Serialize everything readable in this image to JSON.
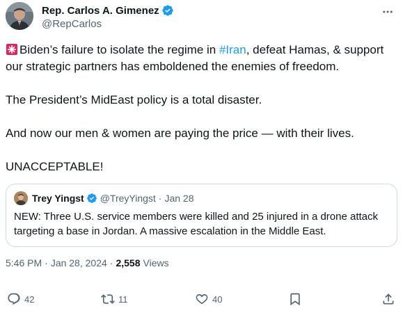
{
  "author": {
    "display_name": "Rep. Carlos A. Gimenez",
    "handle": "@RepCarlos"
  },
  "tweet": {
    "siren_icon": "police-siren-emoji",
    "line1_pre": "Biden’s failure to isolate the regime in ",
    "hashtag": "#Iran",
    "line1_post": ", defeat Hamas, & support our strategic partners has emboldened the enemies of freedom.",
    "para2": "The President’s MidEast policy is a total disaster.",
    "para3": "And now our men & women are paying the price — with their lives.",
    "para4": "UNACCEPTABLE!"
  },
  "quote": {
    "name": "Trey Yingst",
    "handle": "@TreyYingst",
    "date": "Jan 28",
    "text": "NEW: Three U.S. service members were killed and 25 injured in a drone attack targeting a base in Jordan. A massive escalation in the Middle East."
  },
  "meta": {
    "time": "5:46 PM",
    "date": "Jan 28, 2024",
    "views_count": "2,558",
    "views_label": "Views"
  },
  "actions": {
    "replies": "42",
    "reposts": "11",
    "likes": "40"
  },
  "colors": {
    "accent": "#1d9bf0",
    "text": "#0f1419",
    "muted": "#536471",
    "border": "#cfd9de"
  }
}
